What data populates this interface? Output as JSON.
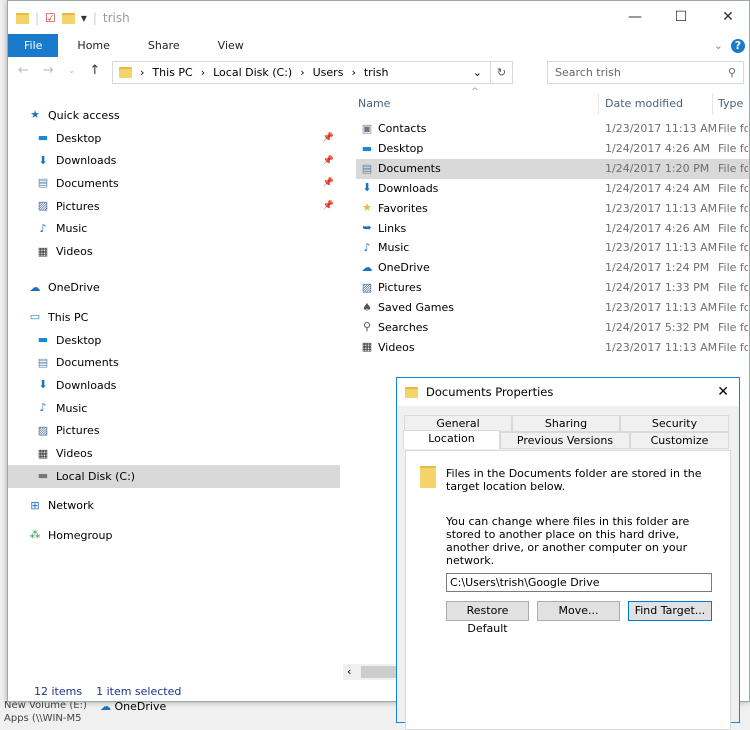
{
  "window": {
    "title": "trish",
    "minimize": "—",
    "maximize": "☐",
    "close": "✕"
  },
  "ribbon": {
    "tabs": [
      "File",
      "Home",
      "Share",
      "View"
    ]
  },
  "address": {
    "crumbs": [
      "This PC",
      "Local Disk (C:)",
      "Users",
      "trish"
    ],
    "search_placeholder": "Search trish"
  },
  "nav": [
    {
      "label": "Quick access",
      "icon": "star-icon",
      "group": true
    },
    {
      "label": "Desktop",
      "icon": "desktop-icon",
      "pinned": true
    },
    {
      "label": "Downloads",
      "icon": "download-icon",
      "pinned": true
    },
    {
      "label": "Documents",
      "icon": "document-icon",
      "pinned": true
    },
    {
      "label": "Pictures",
      "icon": "picture-icon",
      "pinned": true
    },
    {
      "label": "Music",
      "icon": "music-icon"
    },
    {
      "label": "Videos",
      "icon": "video-icon"
    },
    {
      "label": "OneDrive",
      "icon": "cloud-icon",
      "group": true
    },
    {
      "label": "This PC",
      "icon": "computer-icon",
      "group": true
    },
    {
      "label": "Desktop",
      "icon": "desktop-icon"
    },
    {
      "label": "Documents",
      "icon": "document-icon"
    },
    {
      "label": "Downloads",
      "icon": "download-icon"
    },
    {
      "label": "Music",
      "icon": "music-icon"
    },
    {
      "label": "Pictures",
      "icon": "picture-icon"
    },
    {
      "label": "Videos",
      "icon": "video-icon"
    },
    {
      "label": "Local Disk (C:)",
      "icon": "drive-icon",
      "selected": true
    },
    {
      "label": "Network",
      "icon": "network-icon",
      "group": true
    },
    {
      "label": "Homegroup",
      "icon": "homegroup-icon",
      "group": true
    }
  ],
  "columns": {
    "name": "Name",
    "date": "Date modified",
    "type": "Type"
  },
  "files": [
    {
      "name": "Contacts",
      "date": "1/23/2017 11:13 AM",
      "type": "File folder"
    },
    {
      "name": "Desktop",
      "date": "1/24/2017 4:26 AM",
      "type": "File folder"
    },
    {
      "name": "Documents",
      "date": "1/24/2017 1:20 PM",
      "type": "File folder",
      "selected": true
    },
    {
      "name": "Downloads",
      "date": "1/24/2017 4:24 AM",
      "type": "File folder"
    },
    {
      "name": "Favorites",
      "date": "1/23/2017 11:13 AM",
      "type": "File folder"
    },
    {
      "name": "Links",
      "date": "1/24/2017 4:26 AM",
      "type": "File folder"
    },
    {
      "name": "Music",
      "date": "1/23/2017 11:13 AM",
      "type": "File folder"
    },
    {
      "name": "OneDrive",
      "date": "1/24/2017 1:24 PM",
      "type": "File folder"
    },
    {
      "name": "Pictures",
      "date": "1/24/2017 1:33 PM",
      "type": "File folder"
    },
    {
      "name": "Saved Games",
      "date": "1/23/2017 11:13 AM",
      "type": "File folder"
    },
    {
      "name": "Searches",
      "date": "1/24/2017 5:32 PM",
      "type": "File folder"
    },
    {
      "name": "Videos",
      "date": "1/23/2017 11:13 AM",
      "type": "File folder"
    }
  ],
  "status": {
    "count": "12 items",
    "selected": "1 item selected"
  },
  "background": {
    "onedrive": "OneDrive",
    "volume": "New Volume (E:)",
    "apps": "Apps (\\\\WIN-M5"
  },
  "dialog": {
    "title": "Documents Properties",
    "close": "✕",
    "tabs_top": [
      "General",
      "Sharing",
      "Security"
    ],
    "tabs_bottom": [
      "Location",
      "Previous Versions",
      "Customize"
    ],
    "info": "Files in the Documents folder are stored in the target location below.",
    "desc": "You can change where files in this folder are stored to another place on this hard drive, another drive, or another computer on your network.",
    "path": "C:\\Users\\trish\\Google Drive",
    "buttons": [
      "Restore Default",
      "Move...",
      "Find Target..."
    ]
  }
}
